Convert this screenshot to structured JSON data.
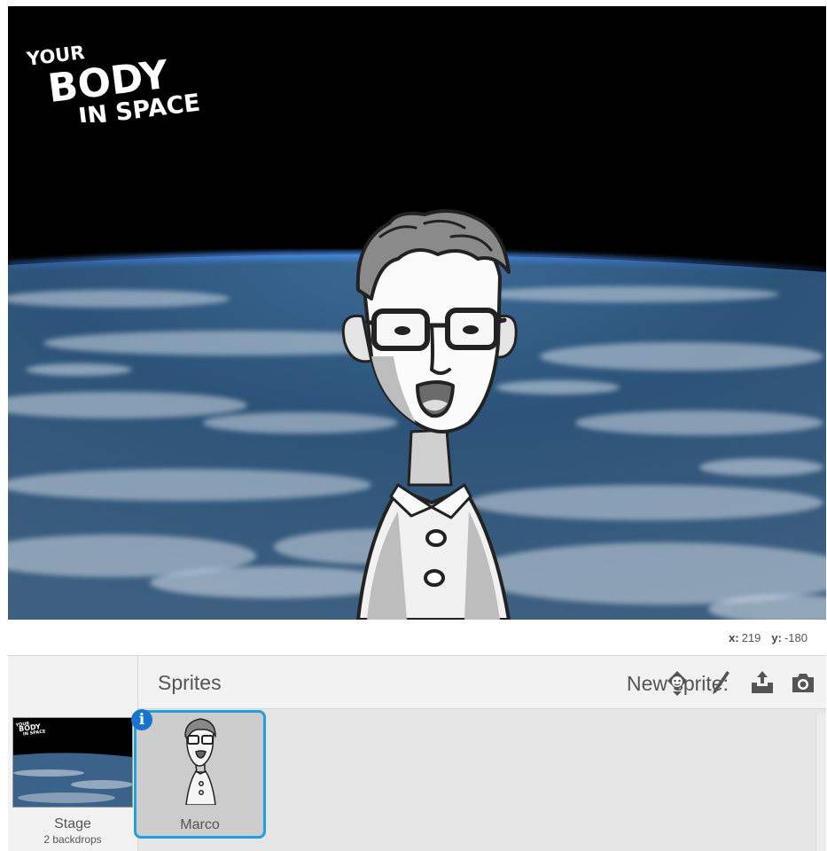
{
  "stage": {
    "logo": [
      "YOUR",
      "BODY",
      "IN SPACE"
    ]
  },
  "coords": {
    "x_label": "x:",
    "x_value": "219",
    "y_label": "y:",
    "y_value": "-180"
  },
  "sprites_panel": {
    "title": "Sprites",
    "new_sprite_label": "New sprite:",
    "new_sprite_icons": [
      "sprite-library-icon",
      "paintbrush-icon",
      "upload-icon",
      "camera-icon"
    ]
  },
  "stage_item": {
    "label": "Stage",
    "sub": "2 backdrops"
  },
  "sprites": [
    {
      "name": "Marco",
      "selected": true
    }
  ],
  "colors": {
    "selection": "#1fa0e0",
    "info": "#1875cf"
  }
}
